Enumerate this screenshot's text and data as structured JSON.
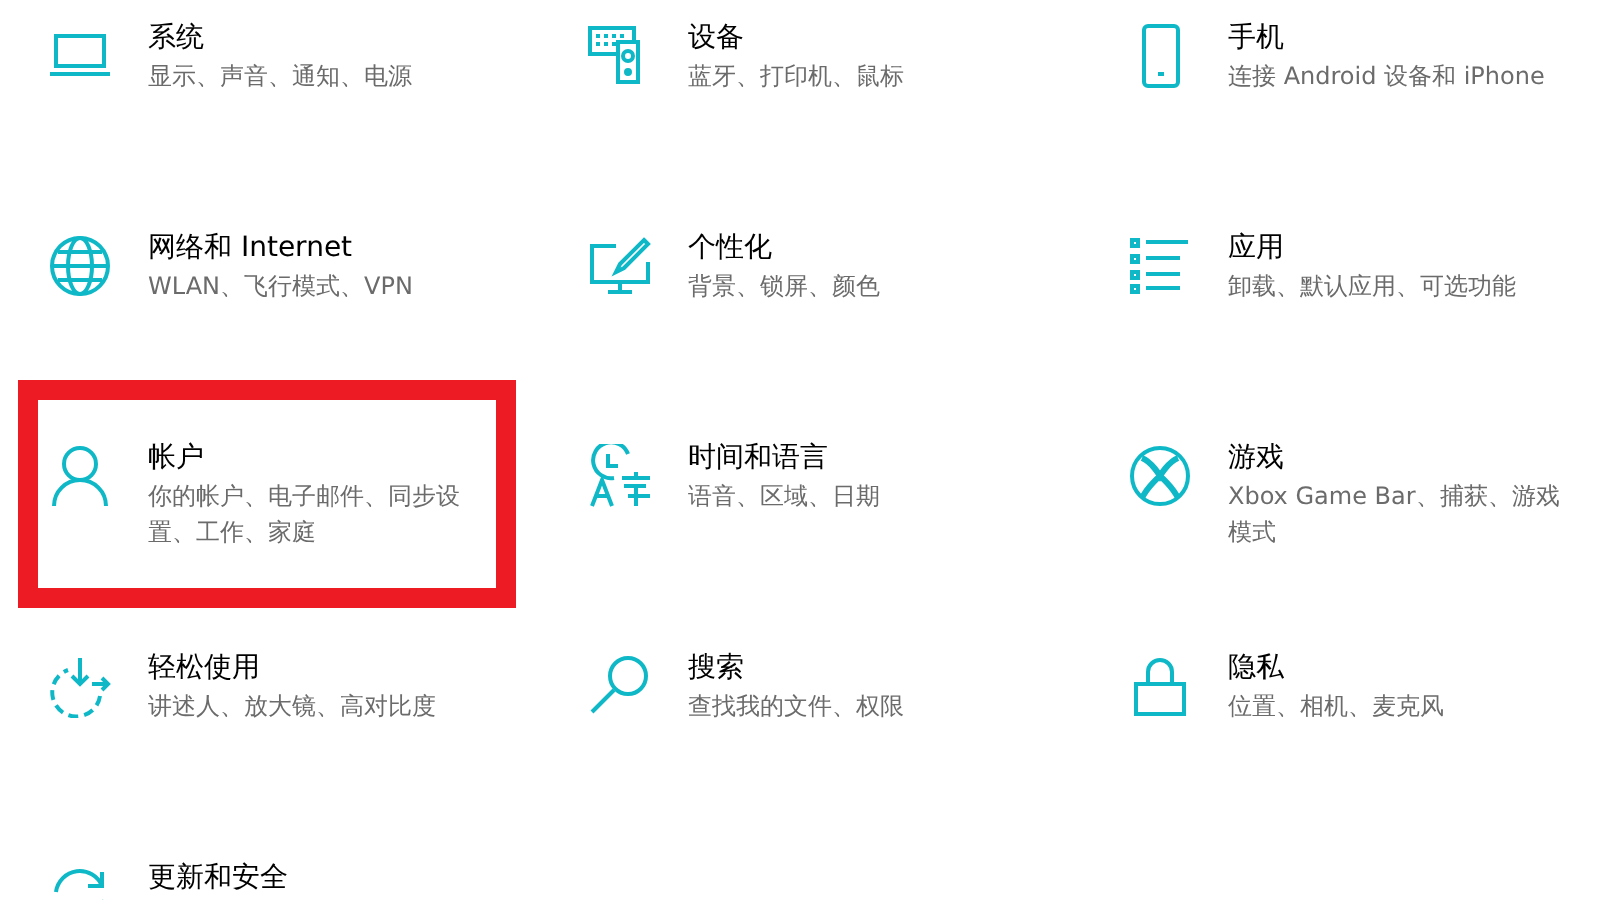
{
  "categories": [
    {
      "title": "系统",
      "subtitle": "显示、声音、通知、电源",
      "highlighted": false
    },
    {
      "title": "设备",
      "subtitle": "蓝牙、打印机、鼠标",
      "highlighted": false
    },
    {
      "title": "手机",
      "subtitle": "连接 Android 设备和 iPhone",
      "highlighted": false
    },
    {
      "title": "网络和 Internet",
      "subtitle": "WLAN、飞行模式、VPN",
      "highlighted": false
    },
    {
      "title": "个性化",
      "subtitle": "背景、锁屏、颜色",
      "highlighted": false
    },
    {
      "title": "应用",
      "subtitle": "卸载、默认应用、可选功能",
      "highlighted": false
    },
    {
      "title": "帐户",
      "subtitle": "你的帐户、电子邮件、同步设置、工作、家庭",
      "highlighted": true
    },
    {
      "title": "时间和语言",
      "subtitle": "语音、区域、日期",
      "highlighted": false
    },
    {
      "title": "游戏",
      "subtitle": "Xbox Game Bar、捕获、游戏模式",
      "highlighted": false
    },
    {
      "title": "轻松使用",
      "subtitle": "讲述人、放大镜、高对比度",
      "highlighted": false
    },
    {
      "title": "搜索",
      "subtitle": "查找我的文件、权限",
      "highlighted": false
    },
    {
      "title": "隐私",
      "subtitle": "位置、相机、麦克风",
      "highlighted": false
    },
    {
      "title": "更新和安全",
      "highlighted": false
    }
  ]
}
